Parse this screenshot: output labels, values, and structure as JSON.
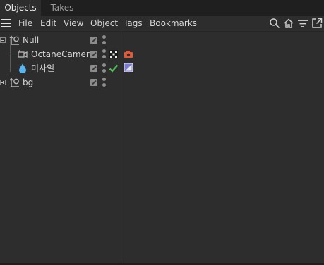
{
  "tabs": [
    {
      "label": "Objects",
      "active": true
    },
    {
      "label": "Takes",
      "active": false
    }
  ],
  "menu": {
    "items": [
      "File",
      "Edit",
      "View",
      "Object",
      "Tags",
      "Bookmarks"
    ]
  },
  "toolbar_icons": [
    "search-icon",
    "home-icon",
    "filter-icon",
    "new-window-icon"
  ],
  "objects": [
    {
      "name": "Null",
      "icon": "null-icon",
      "expanded": true,
      "level": 0,
      "tags": []
    },
    {
      "name": "OctaneCamera",
      "icon": "camera-icon",
      "level": 1,
      "tags": [
        "octane-camera-tag-icon",
        "camera-tag-icon"
      ]
    },
    {
      "name": "미사일",
      "icon": "water-drop-icon",
      "level": 1,
      "checkmark": true,
      "tags": [
        "material-tag-icon"
      ]
    },
    {
      "name": "bg",
      "icon": "null-icon",
      "expanded": false,
      "level": 0,
      "tags": []
    }
  ],
  "colors": {
    "background": "#2d2d2d",
    "tabbar": "#1f1f1f",
    "checkmark": "#4fc35a",
    "camera_tag": "#e05a3a",
    "material_tag": "#7b7bd6",
    "drop_icon": "#5ab4f0"
  }
}
